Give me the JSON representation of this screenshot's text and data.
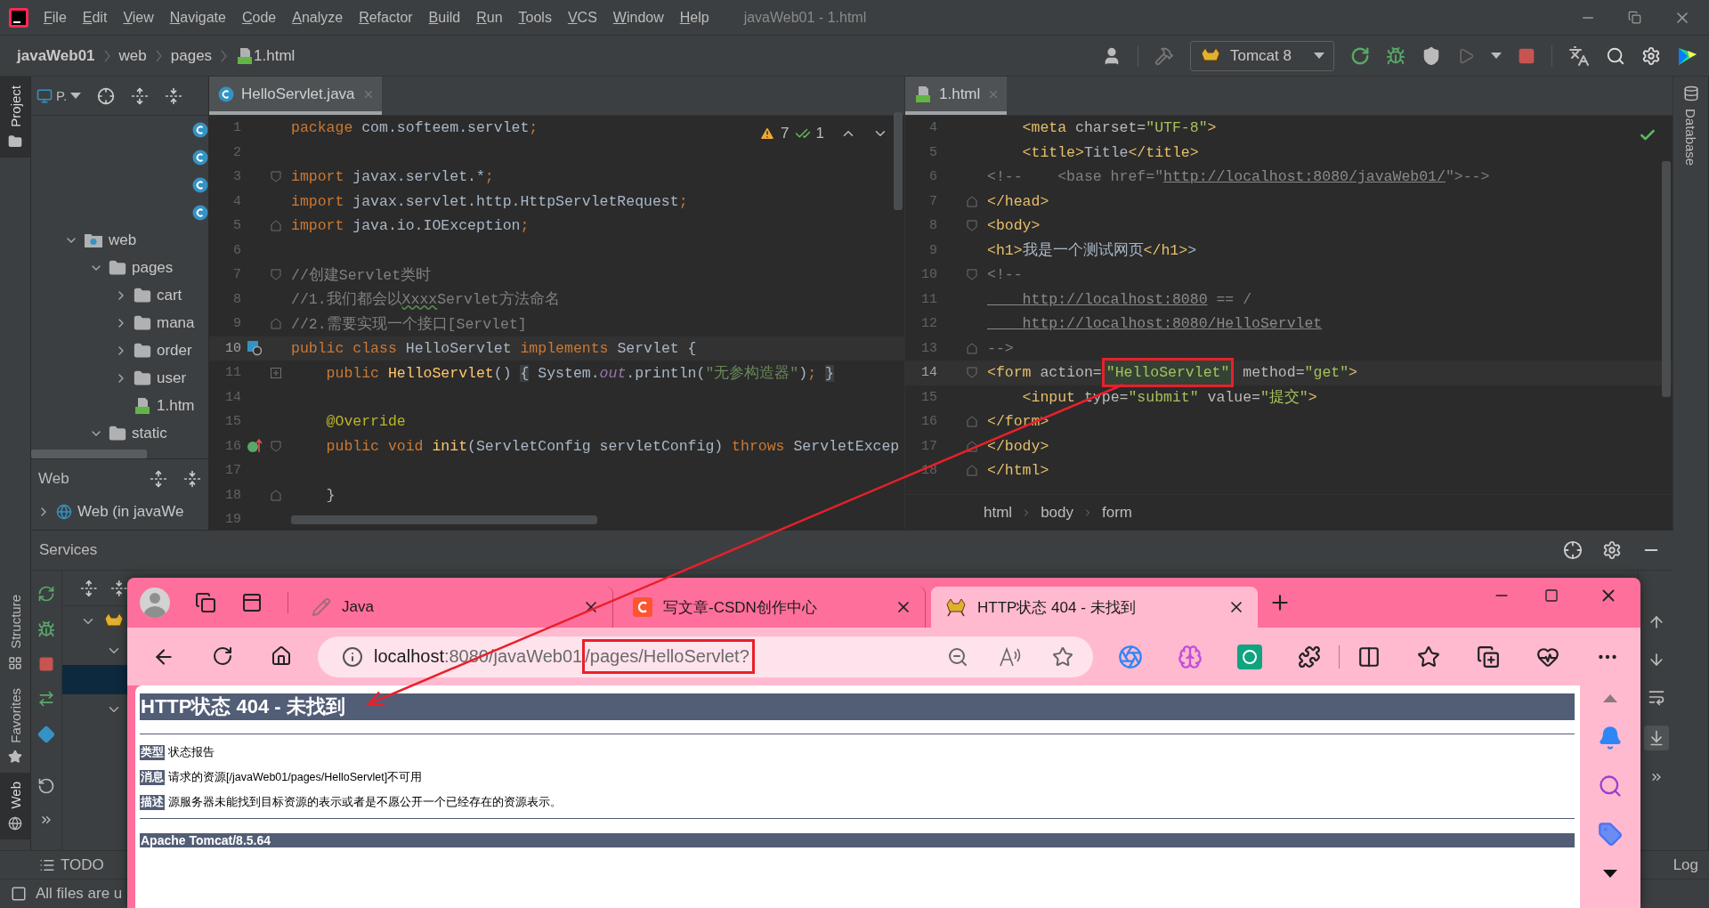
{
  "menu_bar": {
    "items": [
      "File",
      "Edit",
      "View",
      "Navigate",
      "Code",
      "Analyze",
      "Refactor",
      "Build",
      "Run",
      "Tools",
      "VCS",
      "Window",
      "Help"
    ],
    "window_title": "javaWeb01 - 1.html"
  },
  "breadcrumb": [
    {
      "label": "javaWeb01",
      "kind": "project"
    },
    {
      "label": "web",
      "kind": "folder"
    },
    {
      "label": "pages",
      "kind": "folder"
    },
    {
      "label": "1.html",
      "kind": "html"
    }
  ],
  "run_config": "Tomcat 8",
  "left_stripe": [
    {
      "label": "Project",
      "kind": "project",
      "selected": true
    },
    {
      "label": "Structure",
      "kind": "structure",
      "selected": false
    },
    {
      "label": "Favorites",
      "kind": "favorites",
      "selected": false
    },
    {
      "label": "Web",
      "kind": "web",
      "selected": true
    }
  ],
  "right_stripe": [
    {
      "label": "Database"
    }
  ],
  "project_panel": {
    "view_label": "P.",
    "tree": [
      {
        "kind": "class"
      },
      {
        "kind": "class"
      },
      {
        "kind": "class"
      },
      {
        "kind": "class"
      },
      {
        "label": "web",
        "kind": "web",
        "expanded": true,
        "children": [
          {
            "label": "pages",
            "kind": "folder",
            "expanded": true,
            "children": [
              {
                "label": "cart",
                "kind": "folder",
                "expanded": false
              },
              {
                "label": "mana",
                "kind": "folder",
                "expanded": false
              },
              {
                "label": "order",
                "kind": "folder",
                "expanded": false
              },
              {
                "label": "user",
                "kind": "folder",
                "expanded": false
              },
              {
                "label": "1.htm",
                "kind": "html"
              }
            ]
          },
          {
            "label": "static",
            "kind": "folder",
            "expanded": true
          }
        ]
      }
    ]
  },
  "web_panel": {
    "title": "Web",
    "items": [
      {
        "label": "Web (in javaWe",
        "expanded": false
      }
    ]
  },
  "editors": [
    {
      "tab": {
        "label": "HelloServlet.java",
        "kind": "java",
        "selected": true
      },
      "inspections": {
        "kind": "counts",
        "warnings": "7",
        "ok": "1"
      },
      "lines": [
        {
          "n": "1",
          "current": false,
          "segs": [
            {
              "text": "package ",
              "kind": "kw"
            },
            {
              "text": "com.softeem.servlet",
              "kind": "id"
            },
            {
              "text": ";",
              "kind": "kw"
            }
          ]
        },
        {
          "n": "2",
          "current": false
        },
        {
          "n": "3",
          "current": false,
          "fold": {
            "kind": "open"
          },
          "segs": [
            {
              "text": "import ",
              "kind": "kw"
            },
            {
              "text": "javax.servlet.*",
              "kind": "id"
            },
            {
              "text": ";",
              "kind": "kw"
            }
          ]
        },
        {
          "n": "4",
          "current": false,
          "segs": [
            {
              "text": "import ",
              "kind": "kw"
            },
            {
              "text": "javax.servlet.http.HttpServletRequest",
              "kind": "id"
            },
            {
              "text": ";",
              "kind": "kw"
            }
          ]
        },
        {
          "n": "5",
          "current": false,
          "fold": {
            "kind": "close"
          },
          "segs": [
            {
              "text": "import ",
              "kind": "kw"
            },
            {
              "text": "java.io.IOException",
              "kind": "id"
            },
            {
              "text": ";",
              "kind": "kw"
            }
          ]
        },
        {
          "n": "6",
          "current": false
        },
        {
          "n": "7",
          "current": false,
          "fold": {
            "kind": "open"
          },
          "segs": [
            {
              "text": "//创建Servlet类时",
              "kind": "cmt"
            }
          ]
        },
        {
          "n": "8",
          "current": false,
          "segs": [
            {
              "text": "//1.我们都会以",
              "kind": "cmt"
            },
            {
              "text": "Xxxx",
              "kind": "typo"
            },
            {
              "text": "Servlet方法命名",
              "kind": "cmt"
            }
          ]
        },
        {
          "n": "9",
          "current": false,
          "fold": {
            "kind": "close"
          },
          "segs": [
            {
              "text": "//2.需要实现一个接口[Servlet]",
              "kind": "cmt"
            }
          ]
        },
        {
          "n": "10",
          "current": true,
          "gutter": {
            "kind": "implements"
          },
          "segs": [
            {
              "text": "public class ",
              "kind": "kw"
            },
            {
              "text": "HelloServlet ",
              "kind": "id"
            },
            {
              "text": "implements ",
              "kind": "kw"
            },
            {
              "text": "Servlet {",
              "kind": "id"
            }
          ]
        },
        {
          "n": "11",
          "current": false,
          "fold": {
            "kind": "collapsed"
          },
          "segs": [
            {
              "text": "    public ",
              "kind": "kw"
            },
            {
              "text": "HelloServlet",
              "kind": "meth"
            },
            {
              "text": "() ",
              "kind": "id"
            },
            {
              "text": "{",
              "kind": "fold"
            },
            {
              "text": " System.",
              "kind": "id"
            },
            {
              "text": "out",
              "kind": "field"
            },
            {
              "text": ".println(",
              "kind": "id"
            },
            {
              "text": "\"无参构造器\"",
              "kind": "str"
            },
            {
              "text": ")",
              "kind": "id"
            },
            {
              "text": "; ",
              "kind": "kw"
            },
            {
              "text": "}",
              "kind": "fold"
            }
          ]
        },
        {
          "n": "14",
          "current": false
        },
        {
          "n": "15",
          "current": false,
          "segs": [
            {
              "text": "    @Override",
              "kind": "ann"
            }
          ]
        },
        {
          "n": "16",
          "current": false,
          "fold": {
            "kind": "open"
          },
          "gutter": {
            "kind": "override"
          },
          "segs": [
            {
              "text": "    public void ",
              "kind": "kw"
            },
            {
              "text": "init",
              "kind": "meth"
            },
            {
              "text": "(ServletConfig servletConfig) ",
              "kind": "id"
            },
            {
              "text": "throws ",
              "kind": "kw"
            },
            {
              "text": "ServletExcep",
              "kind": "id"
            }
          ]
        },
        {
          "n": "17",
          "current": false
        },
        {
          "n": "18",
          "current": false,
          "fold": {
            "kind": "close"
          },
          "segs": [
            {
              "text": "    }",
              "kind": "id"
            }
          ]
        },
        {
          "n": "19",
          "current": false
        }
      ]
    },
    {
      "tab": {
        "label": "1.html",
        "kind": "html",
        "selected": true
      },
      "inspections": {
        "kind": "clean"
      },
      "lines": [
        {
          "n": "4",
          "current": false,
          "segs": [
            {
              "text": "    <meta ",
              "kind": "tag"
            },
            {
              "text": "charset=",
              "kind": "attr"
            },
            {
              "text": "\"UTF-8\"",
              "kind": "val"
            },
            {
              "text": ">",
              "kind": "tag"
            }
          ]
        },
        {
          "n": "5",
          "current": false,
          "segs": [
            {
              "text": "    <title>",
              "kind": "tag"
            },
            {
              "text": "Title",
              "kind": "id"
            },
            {
              "text": "</title>",
              "kind": "tag"
            }
          ]
        },
        {
          "n": "6",
          "current": false,
          "segs": [
            {
              "text": "<!--    <base href=\"",
              "kind": "cmt"
            },
            {
              "text": "http://localhost:8080/javaWeb01/",
              "kind": "link"
            },
            {
              "text": "\">-->",
              "kind": "cmt"
            }
          ]
        },
        {
          "n": "7",
          "current": false,
          "fold": {
            "kind": "close"
          },
          "segs": [
            {
              "text": "</head>",
              "kind": "tag"
            }
          ]
        },
        {
          "n": "8",
          "current": false,
          "fold": {
            "kind": "open"
          },
          "segs": [
            {
              "text": "<body>",
              "kind": "tag"
            }
          ]
        },
        {
          "n": "9",
          "current": false,
          "segs": [
            {
              "text": "<h1>",
              "kind": "tag"
            },
            {
              "text": "我是一个测试网页",
              "kind": "id"
            },
            {
              "text": "</h1>",
              "kind": "tag"
            },
            {
              "text": ">",
              "kind": "id"
            }
          ]
        },
        {
          "n": "10",
          "current": false,
          "fold": {
            "kind": "open"
          },
          "segs": [
            {
              "text": "<!--",
              "kind": "cmt"
            }
          ]
        },
        {
          "n": "11",
          "current": false,
          "segs": [
            {
              "text": "    http://localhost:8080",
              "kind": "link"
            },
            {
              "text": " == /",
              "kind": "cmt"
            }
          ]
        },
        {
          "n": "12",
          "current": false,
          "segs": [
            {
              "text": "    http://localhost:8080/HelloServlet",
              "kind": "link"
            }
          ]
        },
        {
          "n": "13",
          "current": false,
          "fold": {
            "kind": "close"
          },
          "segs": [
            {
              "text": "-->",
              "kind": "cmt"
            }
          ]
        },
        {
          "n": "14",
          "current": true,
          "fold": {
            "kind": "open"
          },
          "segs": [
            {
              "text": "<form ",
              "kind": "tag"
            },
            {
              "text": "action=",
              "kind": "attr"
            },
            {
              "text": "\"HelloServlet\"",
              "kind": "val",
              "boxed": true
            },
            {
              "text": " method=",
              "kind": "attr"
            },
            {
              "text": "\"get\"",
              "kind": "val"
            },
            {
              "text": ">",
              "kind": "tag"
            }
          ]
        },
        {
          "n": "15",
          "current": false,
          "segs": [
            {
              "text": "    <input ",
              "kind": "tag"
            },
            {
              "text": "type=",
              "kind": "attr"
            },
            {
              "text": "\"submit\"",
              "kind": "val"
            },
            {
              "text": " value=",
              "kind": "attr"
            },
            {
              "text": "\"提交\"",
              "kind": "val"
            },
            {
              "text": ">",
              "kind": "tag"
            }
          ]
        },
        {
          "n": "16",
          "current": false,
          "fold": {
            "kind": "close"
          },
          "segs": [
            {
              "text": "</form>",
              "kind": "tag"
            }
          ]
        },
        {
          "n": "17",
          "current": false,
          "fold": {
            "kind": "close"
          },
          "segs": [
            {
              "text": "</body>",
              "kind": "tag"
            }
          ]
        },
        {
          "n": "18",
          "current": false,
          "fold": {
            "kind": "close"
          },
          "segs": [
            {
              "text": "</html>",
              "kind": "tag"
            }
          ]
        }
      ],
      "footer": [
        "html",
        "body",
        "form"
      ]
    }
  ],
  "services": {
    "title": "Services",
    "tree": [
      {
        "kind": "server",
        "expanded": true,
        "selected": false,
        "children": [
          {
            "expanded": true,
            "selected": false
          },
          {
            "selected": true
          },
          {
            "expanded": true,
            "selected": false
          }
        ]
      }
    ]
  },
  "bottom_bar": {
    "tool": "TODO",
    "right_tool": "Log"
  },
  "status": "All files are u",
  "browser": {
    "tabs": [
      {
        "title": "Java",
        "kind": "notes",
        "selected": false
      },
      {
        "title": "写文章-CSDN创作中心",
        "kind": "csdn",
        "selected": false
      },
      {
        "title": "HTTP状态 404 - 未找到",
        "kind": "tomcat",
        "selected": true
      }
    ],
    "url": [
      {
        "text": "localhost",
        "kind": "host"
      },
      {
        "text": ":8080/javaWeb01",
        "kind": "path"
      },
      {
        "text": "/pages/HelloServlet?",
        "kind": "path",
        "boxed": true
      }
    ],
    "page": {
      "heading": "HTTP状态 404 - 未找到",
      "rows": [
        {
          "label": "类型",
          "text": "状态报告"
        },
        {
          "label": "消息",
          "text": "请求的资源[/javaWeb01/pages/HelloServlet]不可用"
        },
        {
          "label": "描述",
          "text": "源服务器未能找到目标资源的表示或者是不愿公开一个已经存在的资源表示。"
        }
      ],
      "footer": "Apache Tomcat/8.5.64"
    }
  }
}
